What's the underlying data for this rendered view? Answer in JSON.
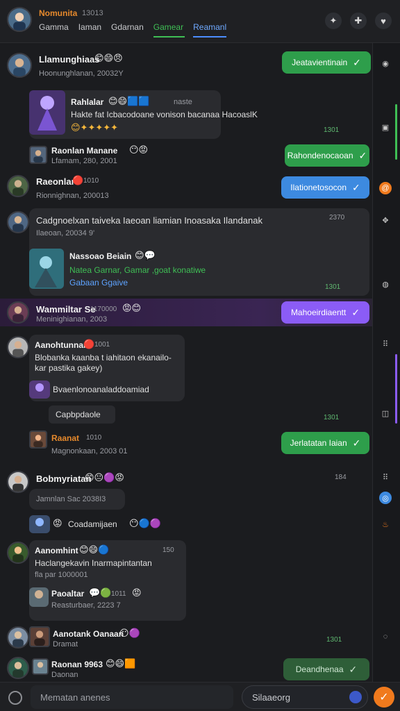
{
  "header": {
    "title": "Nomunita",
    "subtitle": "13013",
    "tabs": [
      "Gamma",
      "Iaman",
      "Gdarnan",
      "Gamear",
      "Reamanl"
    ]
  },
  "messages": [
    {
      "name": "Llamunghiaas",
      "subline": "Hoonunghlanan, 20032Y",
      "action": "Jeatavientinain"
    },
    {
      "card_title": "Rahlalar",
      "card_hint": "naste",
      "card_text": "Hakte fat Icbacodoane vonison bacanaa HacoaslK",
      "time": "1301"
    },
    {
      "name": "Raonlan Manane",
      "subline": "Lfamam, 280, 2001",
      "action": "Rahondenocaoan"
    },
    {
      "name": "Raeonlar",
      "time": "1010",
      "subline": "Rionnighnan, 200013",
      "action": "Ilationetosocon"
    },
    {
      "text": "Cadgnoelxan taiveka Iaeoan liamian Inoasaka Ilandanak",
      "subline": "Ilaeoan, 20034 9'",
      "time": "2370",
      "card_title": "Nassoao Beiain",
      "card_text": "Natea Garnar, Gamar ,goat konatiwe",
      "link": "Gabaan Ggaive",
      "time2": "1301"
    },
    {
      "name": "Wammiltar Se",
      "time": "1170000",
      "subline": "Meninighianan, 2003",
      "action": "Mahoeirdiaentt"
    },
    {
      "name": "Aanohtunnan",
      "time": "1001",
      "text": "Blobanka kaanba t iahitaon ekanailo-kar pastika gakey)",
      "reply": "Bvaenlonoanaladdoamiad",
      "button": "Capbpdaole",
      "time2": "1301"
    },
    {
      "name": "Raanat",
      "time": "1010",
      "subline": "Magnonkaan, 2003 01",
      "action": "Jerlatatan Iaian"
    },
    {
      "name": "Bobmyriatan",
      "subline": "Jamnlan Sac 2038I3",
      "reply": "Coadamijaen",
      "time": "184"
    },
    {
      "name": "Aanomhint",
      "time": "150",
      "text": "Haclangekavin Inarmapintantan",
      "subline": "fla par 1000001",
      "card_title": "Paoaltar",
      "card_time": "1011",
      "card_sub": "Reasturbaer, 2223 7"
    },
    {
      "name": "Aanotank Oanaan",
      "subline": "Dramat",
      "time": "1301"
    },
    {
      "name": "Raonan 9963",
      "subline": "Daonan",
      "action": "Deandhenaa"
    }
  ],
  "composer": {
    "placeholder": "Mematan anenes",
    "search": "Silaaeorg"
  },
  "colors": {
    "accent_green": "#3fbf55",
    "accent_blue": "#4c8dff",
    "accent_purple": "#8b5cf6",
    "accent_orange": "#f07a1d"
  }
}
